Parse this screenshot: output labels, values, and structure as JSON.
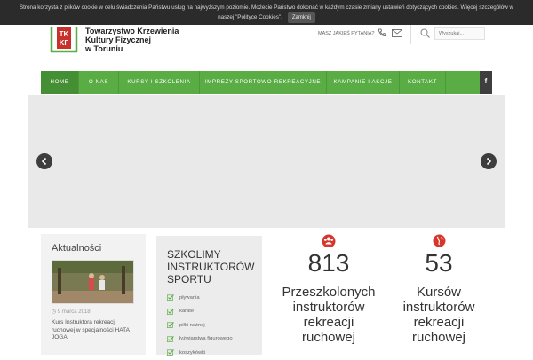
{
  "cookie_bar": {
    "line1": "Strona korzysta z plików cookie w celu świadczenia Państwu usług na najwyższym poziomie. Możecie Państwo dokonać w każdym czasie zmiany ustawień dotyczących cookies. Więcej szczegółów w",
    "line2": "naszej \"Polityce Cookies\".",
    "close_label": "Zamknij"
  },
  "header": {
    "logo_name": "TKKF",
    "org_name": [
      "Towarzystwo Krzewienia",
      "Kultury Fizycznej",
      "w Toruniu"
    ],
    "ask_label": "MASZ JAKIEŚ PYTANIA?",
    "search_placeholder": "Wyszukaj..."
  },
  "nav": {
    "items": [
      "HOME",
      "O NAS",
      "KURSY I SZKOLENIA",
      "IMPREZY SPORTOWO-REKREACYJNE",
      "KAMPANIE I AKCJE",
      "KONTAKT"
    ],
    "social_label": "f",
    "accent_color": "#5aac44"
  },
  "news": {
    "title": "Aktualności",
    "date": "9 marca 2018",
    "text": "Kurs Instruktora rekreacji ruchowej w specjalności HATA JOGA"
  },
  "training": {
    "title": [
      "SZKOLIMY",
      "INSTRUKTORÓW",
      "SPORTU"
    ],
    "items": [
      "pływania",
      "karate",
      "piłki nożnej",
      "łyżwiarstwa figurowego",
      "koszykówki"
    ]
  },
  "stats": [
    {
      "icon": "users-icon",
      "number": "813",
      "label": [
        "Przeszkolonych",
        "instruktorów",
        "rekreacji",
        "ruchowej"
      ]
    },
    {
      "icon": "globe-icon",
      "number": "53",
      "label": [
        "Kursów",
        "instruktorów",
        "rekreacji",
        "ruchowej"
      ]
    }
  ],
  "colors": {
    "stat_icon": "#d6362b",
    "check": "#5aac44",
    "cookie_bg": "#2b2b2b"
  }
}
